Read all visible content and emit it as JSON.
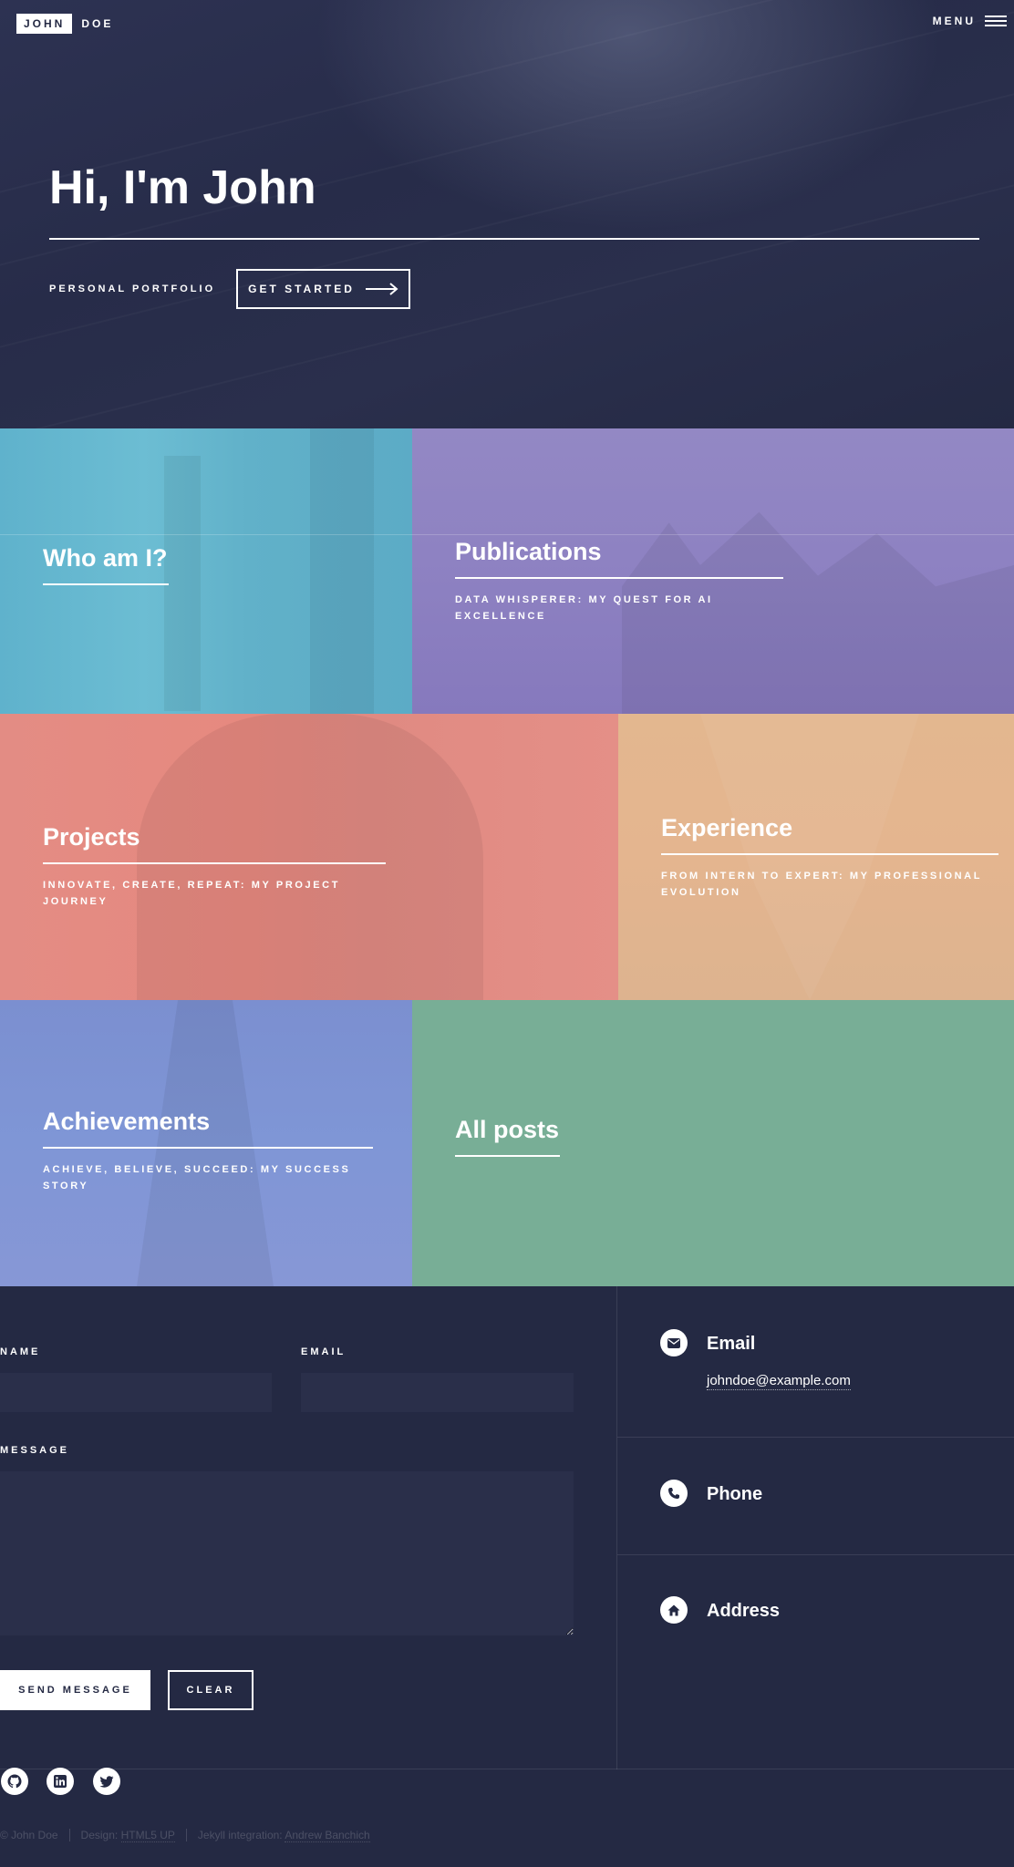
{
  "header": {
    "logo_first": "JOHN",
    "logo_last": "DOE",
    "menu_label": "MENU"
  },
  "banner": {
    "title": "Hi, I'm John",
    "subtitle": "PERSONAL PORTFOLIO",
    "cta_label": "GET STARTED"
  },
  "tiles": [
    {
      "title": "Who am I?",
      "subtitle": ""
    },
    {
      "title": "Publications",
      "subtitle": "DATA WHISPERER: MY QUEST FOR AI EXCELLENCE"
    },
    {
      "title": "Projects",
      "subtitle": "INNOVATE, CREATE, REPEAT: MY PROJECT JOURNEY"
    },
    {
      "title": "Experience",
      "subtitle": "FROM INTERN TO EXPERT: MY PROFESSIONAL EVOLUTION"
    },
    {
      "title": "Achievements",
      "subtitle": "ACHIEVE, BELIEVE, SUCCEED: MY SUCCESS STORY"
    },
    {
      "title": "All posts",
      "subtitle": ""
    }
  ],
  "form": {
    "name_label": "NAME",
    "email_label": "EMAIL",
    "message_label": "MESSAGE",
    "name_value": "",
    "email_value": "",
    "message_value": "",
    "send_label": "SEND MESSAGE",
    "clear_label": "CLEAR"
  },
  "contact_info": {
    "email_title": "Email",
    "email_value": "johndoe@example.com",
    "phone_title": "Phone",
    "address_title": "Address"
  },
  "social": [
    "github-icon",
    "linkedin-icon",
    "twitter-icon"
  ],
  "footer": {
    "copyright": "© John Doe",
    "design_prefix": "Design: ",
    "design_link": "HTML5 UP",
    "jekyll_prefix": "Jekyll integration: ",
    "jekyll_link": "Andrew Banchich"
  },
  "colors": {
    "background": "#242943",
    "tile_blue": "#6cbdd3",
    "tile_purple": "#8e82c2",
    "tile_salmon": "#e6897f",
    "tile_tan": "#e4b58f",
    "tile_periwinkle": "#7f96d6",
    "tile_green": "#78ae96"
  }
}
